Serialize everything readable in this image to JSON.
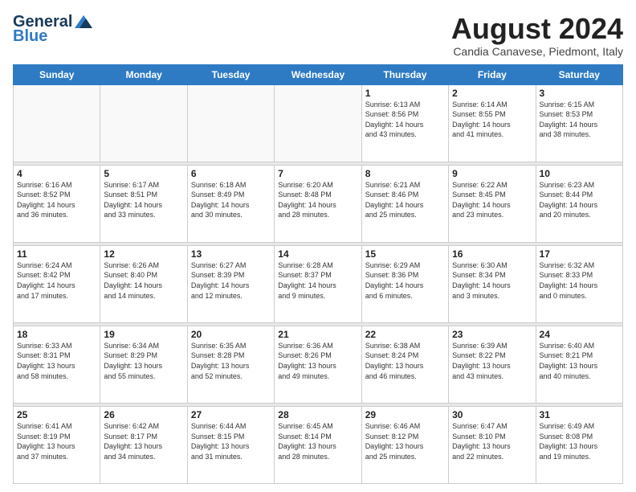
{
  "logo": {
    "line1": "General",
    "line2": "Blue"
  },
  "header": {
    "month": "August 2024",
    "location": "Candia Canavese, Piedmont, Italy"
  },
  "days_of_week": [
    "Sunday",
    "Monday",
    "Tuesday",
    "Wednesday",
    "Thursday",
    "Friday",
    "Saturday"
  ],
  "weeks": [
    [
      {
        "day": "",
        "info": ""
      },
      {
        "day": "",
        "info": ""
      },
      {
        "day": "",
        "info": ""
      },
      {
        "day": "",
        "info": ""
      },
      {
        "day": "1",
        "info": "Sunrise: 6:13 AM\nSunset: 8:56 PM\nDaylight: 14 hours\nand 43 minutes."
      },
      {
        "day": "2",
        "info": "Sunrise: 6:14 AM\nSunset: 8:55 PM\nDaylight: 14 hours\nand 41 minutes."
      },
      {
        "day": "3",
        "info": "Sunrise: 6:15 AM\nSunset: 8:53 PM\nDaylight: 14 hours\nand 38 minutes."
      }
    ],
    [
      {
        "day": "4",
        "info": "Sunrise: 6:16 AM\nSunset: 8:52 PM\nDaylight: 14 hours\nand 36 minutes."
      },
      {
        "day": "5",
        "info": "Sunrise: 6:17 AM\nSunset: 8:51 PM\nDaylight: 14 hours\nand 33 minutes."
      },
      {
        "day": "6",
        "info": "Sunrise: 6:18 AM\nSunset: 8:49 PM\nDaylight: 14 hours\nand 30 minutes."
      },
      {
        "day": "7",
        "info": "Sunrise: 6:20 AM\nSunset: 8:48 PM\nDaylight: 14 hours\nand 28 minutes."
      },
      {
        "day": "8",
        "info": "Sunrise: 6:21 AM\nSunset: 8:46 PM\nDaylight: 14 hours\nand 25 minutes."
      },
      {
        "day": "9",
        "info": "Sunrise: 6:22 AM\nSunset: 8:45 PM\nDaylight: 14 hours\nand 23 minutes."
      },
      {
        "day": "10",
        "info": "Sunrise: 6:23 AM\nSunset: 8:44 PM\nDaylight: 14 hours\nand 20 minutes."
      }
    ],
    [
      {
        "day": "11",
        "info": "Sunrise: 6:24 AM\nSunset: 8:42 PM\nDaylight: 14 hours\nand 17 minutes."
      },
      {
        "day": "12",
        "info": "Sunrise: 6:26 AM\nSunset: 8:40 PM\nDaylight: 14 hours\nand 14 minutes."
      },
      {
        "day": "13",
        "info": "Sunrise: 6:27 AM\nSunset: 8:39 PM\nDaylight: 14 hours\nand 12 minutes."
      },
      {
        "day": "14",
        "info": "Sunrise: 6:28 AM\nSunset: 8:37 PM\nDaylight: 14 hours\nand 9 minutes."
      },
      {
        "day": "15",
        "info": "Sunrise: 6:29 AM\nSunset: 8:36 PM\nDaylight: 14 hours\nand 6 minutes."
      },
      {
        "day": "16",
        "info": "Sunrise: 6:30 AM\nSunset: 8:34 PM\nDaylight: 14 hours\nand 3 minutes."
      },
      {
        "day": "17",
        "info": "Sunrise: 6:32 AM\nSunset: 8:33 PM\nDaylight: 14 hours\nand 0 minutes."
      }
    ],
    [
      {
        "day": "18",
        "info": "Sunrise: 6:33 AM\nSunset: 8:31 PM\nDaylight: 13 hours\nand 58 minutes."
      },
      {
        "day": "19",
        "info": "Sunrise: 6:34 AM\nSunset: 8:29 PM\nDaylight: 13 hours\nand 55 minutes."
      },
      {
        "day": "20",
        "info": "Sunrise: 6:35 AM\nSunset: 8:28 PM\nDaylight: 13 hours\nand 52 minutes."
      },
      {
        "day": "21",
        "info": "Sunrise: 6:36 AM\nSunset: 8:26 PM\nDaylight: 13 hours\nand 49 minutes."
      },
      {
        "day": "22",
        "info": "Sunrise: 6:38 AM\nSunset: 8:24 PM\nDaylight: 13 hours\nand 46 minutes."
      },
      {
        "day": "23",
        "info": "Sunrise: 6:39 AM\nSunset: 8:22 PM\nDaylight: 13 hours\nand 43 minutes."
      },
      {
        "day": "24",
        "info": "Sunrise: 6:40 AM\nSunset: 8:21 PM\nDaylight: 13 hours\nand 40 minutes."
      }
    ],
    [
      {
        "day": "25",
        "info": "Sunrise: 6:41 AM\nSunset: 8:19 PM\nDaylight: 13 hours\nand 37 minutes."
      },
      {
        "day": "26",
        "info": "Sunrise: 6:42 AM\nSunset: 8:17 PM\nDaylight: 13 hours\nand 34 minutes."
      },
      {
        "day": "27",
        "info": "Sunrise: 6:44 AM\nSunset: 8:15 PM\nDaylight: 13 hours\nand 31 minutes."
      },
      {
        "day": "28",
        "info": "Sunrise: 6:45 AM\nSunset: 8:14 PM\nDaylight: 13 hours\nand 28 minutes."
      },
      {
        "day": "29",
        "info": "Sunrise: 6:46 AM\nSunset: 8:12 PM\nDaylight: 13 hours\nand 25 minutes."
      },
      {
        "day": "30",
        "info": "Sunrise: 6:47 AM\nSunset: 8:10 PM\nDaylight: 13 hours\nand 22 minutes."
      },
      {
        "day": "31",
        "info": "Sunrise: 6:49 AM\nSunset: 8:08 PM\nDaylight: 13 hours\nand 19 minutes."
      }
    ]
  ]
}
